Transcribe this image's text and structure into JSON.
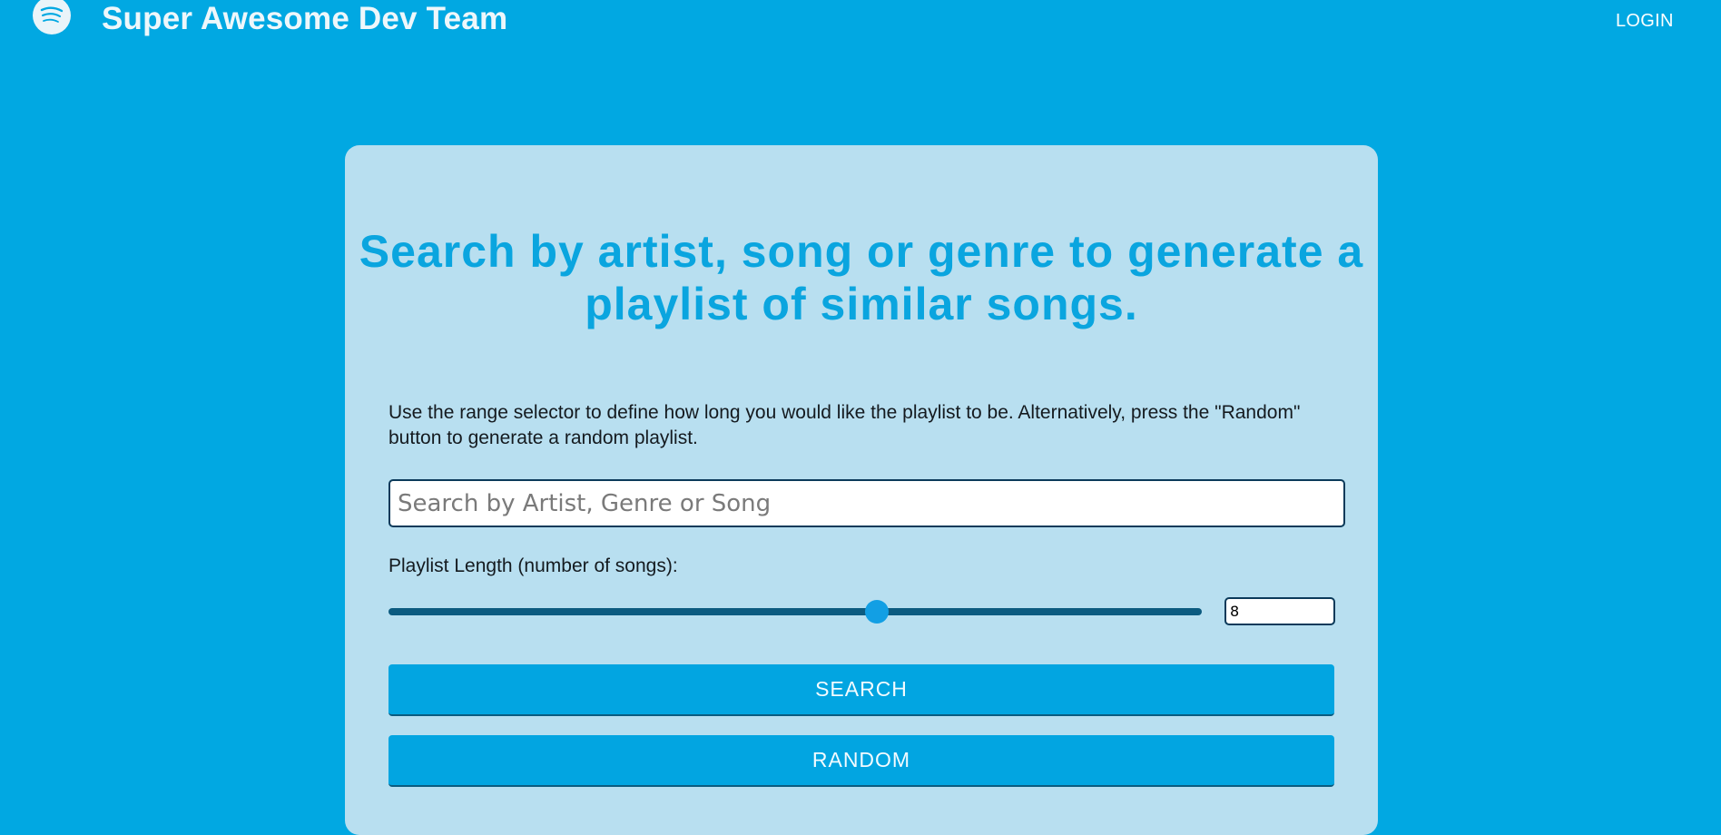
{
  "header": {
    "logo_icon": "spotify-logo-icon",
    "brand": "Super Awesome Dev Team",
    "login_label": "LOGIN"
  },
  "main": {
    "headline": "Search by artist, song or genre to generate a playlist of similar songs.",
    "description": "Use the range selector to define how long you would like the playlist to be. Alternatively, press the \"Random\" button to generate a random playlist.",
    "search": {
      "placeholder": "Search by Artist, Genre or Song",
      "value": ""
    },
    "length": {
      "label": "Playlist Length (number of songs):",
      "value": "8",
      "slider_fraction": 0.6
    },
    "search_button": "SEARCH",
    "random_button": "RANDOM"
  },
  "colors": {
    "background": "#01a8e2",
    "card": "#b8dff0",
    "headline": "#0aa5df",
    "button": "#02a5e1",
    "slider_track": "#0c5b80",
    "slider_thumb": "#129fe4"
  }
}
